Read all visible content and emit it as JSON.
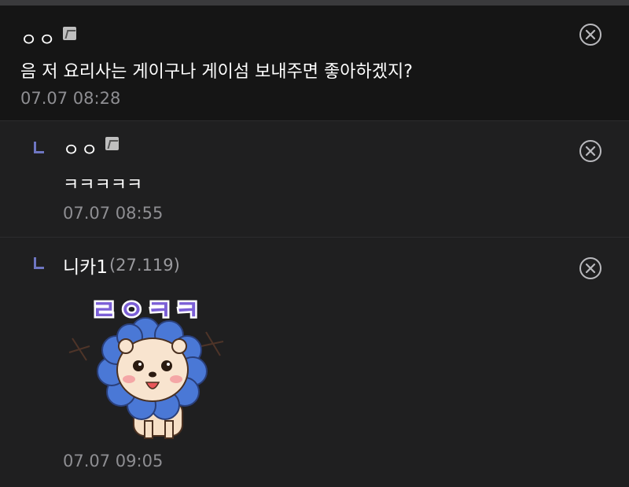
{
  "comments": [
    {
      "author": "ㅇㅇ",
      "text": "음 저 요리사는 게이구나 게이섬 보내주면 좋아하겠지?",
      "time": "07.07 08:28"
    },
    {
      "author": "ㅇㅇ",
      "text": "ㅋㅋㅋㅋㅋ",
      "time": "07.07 08:55"
    },
    {
      "author": "니카1",
      "ip": "(27.119)",
      "sticker_text": "ㄹㅇㅋㅋ",
      "time": "07.07 09:05"
    }
  ],
  "colors": {
    "background": "#1f1f20",
    "top_comment_bg": "#151515",
    "reply_marker": "#6e76c2",
    "timestamp": "#8e8e92",
    "sticker_flower": "#4a78d6",
    "sticker_text": "#7b5fd6"
  },
  "icons": [
    "fixed-nick-badge-icon",
    "close-icon",
    "reply-arrow-icon"
  ]
}
